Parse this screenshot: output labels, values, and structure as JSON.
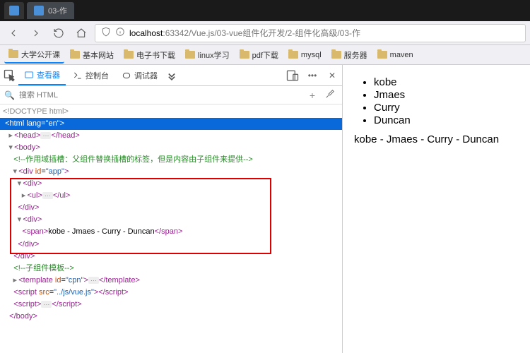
{
  "tab": {
    "title": "03-作"
  },
  "nav": {
    "host": "localhost",
    "port": ":63342",
    "path": "/Vue.js/03-vue组件化开发/2-组件化高级/03-作"
  },
  "bookmarks": [
    "大学公开课",
    "基本网站",
    "电子书下载",
    "linux学习",
    "pdf下载",
    "mysql",
    "服务器",
    "maven"
  ],
  "devtools": {
    "tabs": {
      "inspector": "查看器",
      "console": "控制台",
      "debugger": "调试器"
    },
    "search_placeholder": "搜索 HTML",
    "tree": {
      "doctype": "<!DOCTYPE html>",
      "html_open": "<html lang=\"en\">",
      "head": {
        "open": "<head>",
        "close": "</head>"
      },
      "body_open": "<body>",
      "comment1": "<!--作用域插槽：父组件替换插槽的标签，但是内容由子组件来提供-->",
      "app_open": "<div id=\"app\">",
      "div1": {
        "open": "<div>",
        "ul_open": "<ul>",
        "ul_close": "</ul>",
        "close": "</div>"
      },
      "div2": {
        "open": "<div>",
        "span_open": "<span>",
        "span_text": "kobe - Jmaes - Curry - Duncan",
        "span_close": "</span>",
        "close": "</div>"
      },
      "app_close": "</div>",
      "comment2": "<!--子组件模板-->",
      "tpl": {
        "open": "<template id=\"cpn\">",
        "close": "</template>"
      },
      "script": {
        "open": "<script src=\"../js/vue.js\">",
        "close": "</script>"
      },
      "body_close": "</body>"
    }
  },
  "page": {
    "items": [
      "kobe",
      "Jmaes",
      "Curry",
      "Duncan"
    ],
    "joined": "kobe - Jmaes - Curry - Duncan"
  }
}
